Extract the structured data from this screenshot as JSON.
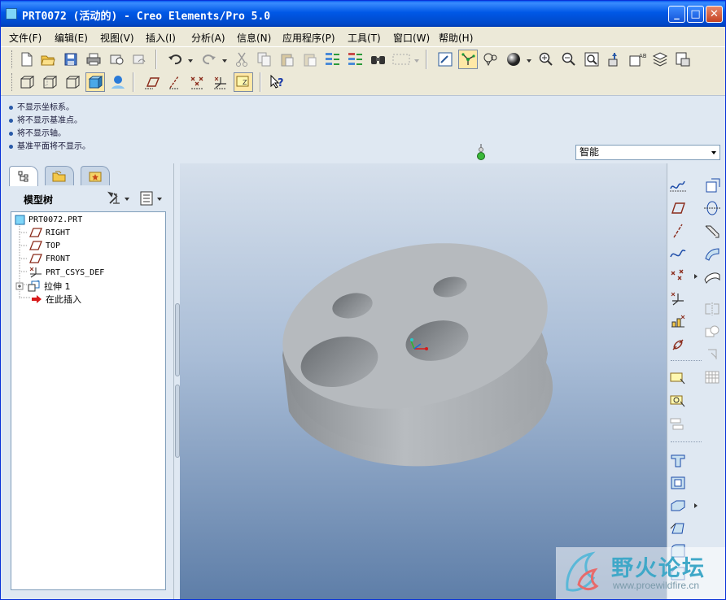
{
  "window": {
    "title": "PRT0072 (活动的) - Creo Elements/Pro 5.0",
    "controls": {
      "minimize": "_",
      "maximize": "□",
      "close": "✕"
    }
  },
  "menu": [
    {
      "label": "文件(F)"
    },
    {
      "label": "编辑(E)"
    },
    {
      "label": "视图(V)"
    },
    {
      "label": "插入(I)"
    },
    {
      "label": "分析(A)"
    },
    {
      "label": "信息(N)"
    },
    {
      "label": "应用程序(P)"
    },
    {
      "label": "工具(T)"
    },
    {
      "label": "窗口(W)"
    },
    {
      "label": "帮助(H)"
    }
  ],
  "messages": [
    "不显示坐标系。",
    "将不显示基准点。",
    "将不显示轴。",
    "基准平面将不显示。"
  ],
  "filter": {
    "value": "智能"
  },
  "navigator": {
    "tree_title": "模型树",
    "tree_items": [
      {
        "label": "PRT0072.PRT",
        "icon": "part-icon"
      },
      {
        "label": "RIGHT",
        "icon": "datum-plane-icon"
      },
      {
        "label": "TOP",
        "icon": "datum-plane-icon"
      },
      {
        "label": "FRONT",
        "icon": "datum-plane-icon"
      },
      {
        "label": "PRT_CSYS_DEF",
        "icon": "csys-icon"
      },
      {
        "label": "拉伸 1",
        "icon": "extrude-icon"
      },
      {
        "label": "在此插入",
        "icon": "insert-here-icon"
      }
    ]
  },
  "watermark": {
    "text": "野火论坛",
    "url": "www.proewildfire.cn"
  },
  "colors": {
    "title_bar": "#0058e6",
    "model": "#b4b8bc",
    "background_top": "#d6e0ec",
    "background_bottom": "#5e7ea8"
  }
}
